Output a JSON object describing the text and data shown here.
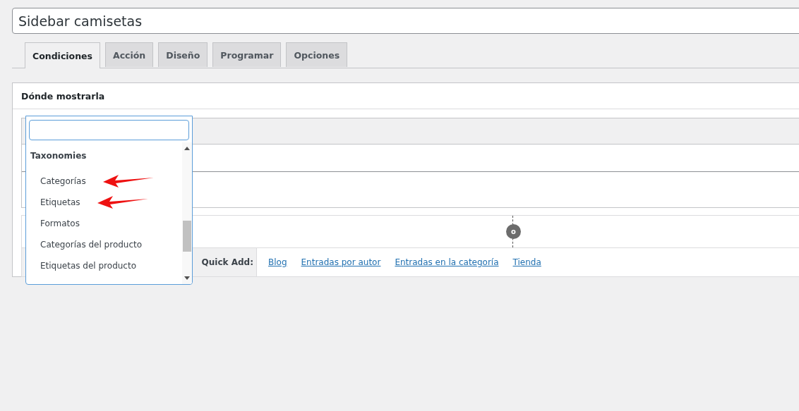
{
  "title_field": {
    "value": "Sidebar camisetas"
  },
  "tabs": [
    {
      "label": "Condiciones",
      "selected": true
    },
    {
      "label": "Acción",
      "selected": false
    },
    {
      "label": "Diseño",
      "selected": false
    },
    {
      "label": "Programar",
      "selected": false
    },
    {
      "label": "Opciones",
      "selected": false
    }
  ],
  "panel": {
    "title": "Dónde mostrarla",
    "operator_badge": "o",
    "quick_add": {
      "label": "Quick Add:",
      "links": [
        "Blog",
        "Entradas por autor",
        "Entradas en la categoría",
        "Tienda"
      ]
    }
  },
  "dropdown": {
    "group": "Taxonomies",
    "options": [
      {
        "label": "Categorías",
        "arrow": true
      },
      {
        "label": "Etiquetas",
        "arrow": true
      },
      {
        "label": "Formatos",
        "arrow": false
      },
      {
        "label": "Categorías del producto",
        "arrow": false
      },
      {
        "label": "Etiquetas del producto",
        "arrow": false
      }
    ]
  }
}
